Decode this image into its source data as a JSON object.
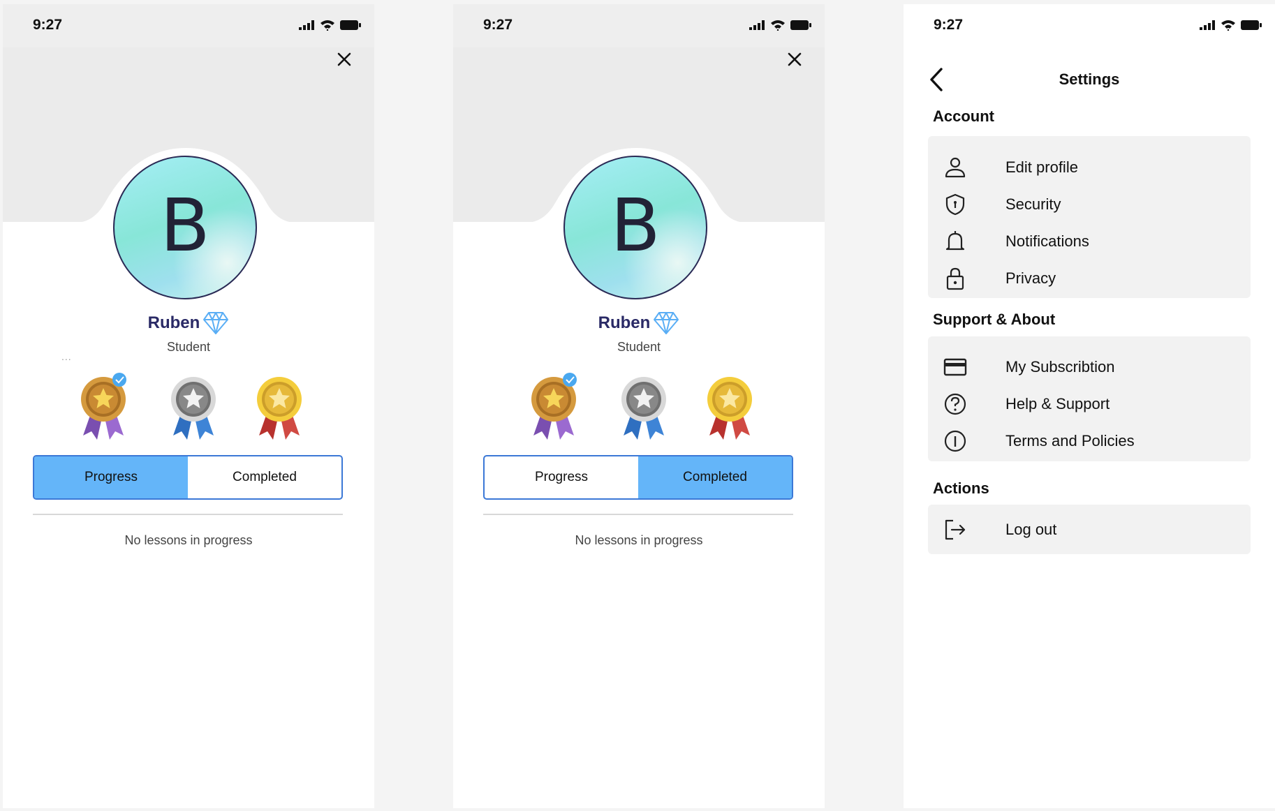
{
  "status_bar": {
    "time": "9:27"
  },
  "profile": {
    "initial": "B",
    "name": "Ruben",
    "role": "Student",
    "more": "...",
    "tabs": [
      "Progress",
      "Completed"
    ],
    "empty_message": "No lessons in progress",
    "medals": [
      {
        "name": "bronze-medal",
        "checked": true
      },
      {
        "name": "silver-medal",
        "checked": false
      },
      {
        "name": "gold-medal",
        "checked": false
      }
    ]
  },
  "screens": [
    {
      "active_tab": "Progress"
    },
    {
      "active_tab": "Completed"
    }
  ],
  "settings": {
    "title": "Settings",
    "sections": [
      {
        "title": "Account",
        "items": [
          {
            "label": "Edit profile",
            "icon": "user-icon"
          },
          {
            "label": "Security",
            "icon": "shield-icon"
          },
          {
            "label": "Notifications",
            "icon": "bell-icon"
          },
          {
            "label": "Privacy",
            "icon": "lock-icon"
          }
        ]
      },
      {
        "title": "Support & About",
        "items": [
          {
            "label": "My Subscribtion",
            "icon": "credit-card-icon"
          },
          {
            "label": "Help & Support",
            "icon": "help-icon"
          },
          {
            "label": "Terms and Policies",
            "icon": "info-icon"
          }
        ]
      },
      {
        "title": "Actions",
        "items": [
          {
            "label": "Log out",
            "icon": "logout-icon"
          }
        ]
      }
    ]
  },
  "colors": {
    "accent": "#64b5f9",
    "tab_border": "#3b78d6",
    "name": "#2a2a66",
    "diamond": "#5aaef5"
  }
}
